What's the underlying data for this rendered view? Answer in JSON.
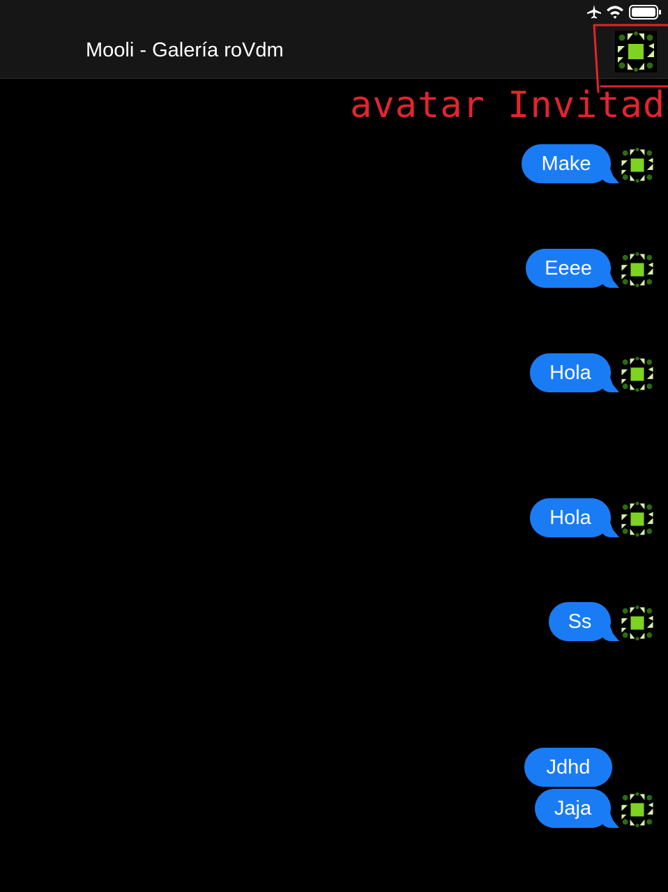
{
  "status_bar": {
    "icons": [
      "airplane-mode-icon",
      "wifi-icon",
      "battery-icon"
    ]
  },
  "header": {
    "title": "Mooli - Galería roVdm",
    "avatar_icon": "guest-avatar-icon"
  },
  "annotation": {
    "text": "avatar Invitado",
    "color": "#e4242e"
  },
  "messages": [
    {
      "text": "Make"
    },
    {
      "text": "Eeee"
    },
    {
      "text": "Hola"
    },
    {
      "text": "Hola"
    },
    {
      "text": "Ss"
    },
    {
      "text": "Jdhd"
    },
    {
      "text": "Jaja"
    }
  ],
  "colors": {
    "bubble": "#1a7cf5",
    "background": "#000000",
    "nav_background": "#161616",
    "avatar_green": "#7ed321",
    "avatar_dark_green": "#2e6b12",
    "avatar_light": "#d8f0a8"
  }
}
